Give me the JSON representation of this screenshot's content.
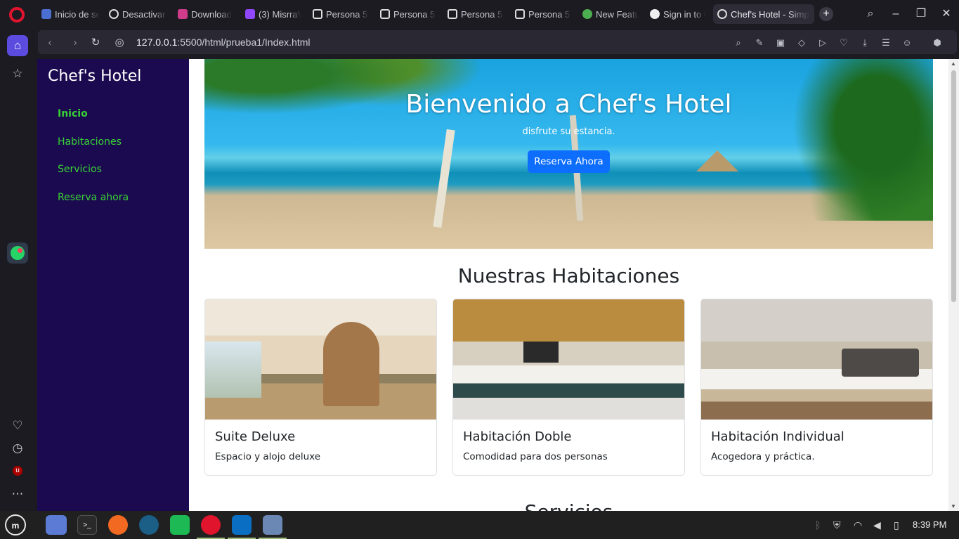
{
  "browser": {
    "tabs": [
      {
        "label": "Inicio de se",
        "active": false
      },
      {
        "label": "Desactivar l",
        "active": false
      },
      {
        "label": "Download",
        "active": false
      },
      {
        "label": "(3) MisrraV",
        "active": false
      },
      {
        "label": "Persona 5 F",
        "active": false
      },
      {
        "label": "Persona 5 F",
        "active": false
      },
      {
        "label": "Persona 5 F",
        "active": false
      },
      {
        "label": "Persona 5 F",
        "active": false
      },
      {
        "label": "New Featu",
        "active": false
      },
      {
        "label": "Sign in to G",
        "active": false
      },
      {
        "label": "Chef's Hotel - Simpl",
        "active": true
      }
    ],
    "url_host": "127.0.0.1",
    "url_rest": ":5500/html/prueba1/Index.html"
  },
  "site": {
    "brand": "Chef's Hotel",
    "nav": [
      {
        "label": "Inicio",
        "active": true
      },
      {
        "label": "Habitaciones",
        "active": false
      },
      {
        "label": "Servicios",
        "active": false
      },
      {
        "label": "Reserva ahora",
        "active": false
      }
    ],
    "hero": {
      "title": "Bienvenido a Chef's Hotel",
      "subtitle": "disfrute su estancia.",
      "button": "Reserva Ahora"
    },
    "rooms": {
      "heading": "Nuestras Habitaciones",
      "cards": [
        {
          "title": "Suite Deluxe",
          "text": "Espacio y alojo deluxe"
        },
        {
          "title": "Habitación Doble",
          "text": "Comodidad para dos personas"
        },
        {
          "title": "Habitación Individual",
          "text": "Acogedora y práctica."
        }
      ]
    },
    "next_section_heading": "Servicios"
  },
  "taskbar": {
    "clock": "8:39 PM"
  },
  "colors": {
    "site_sidebar": "#1b0a4f",
    "nav_link": "#39d335",
    "primary_button": "#0d6efd"
  }
}
